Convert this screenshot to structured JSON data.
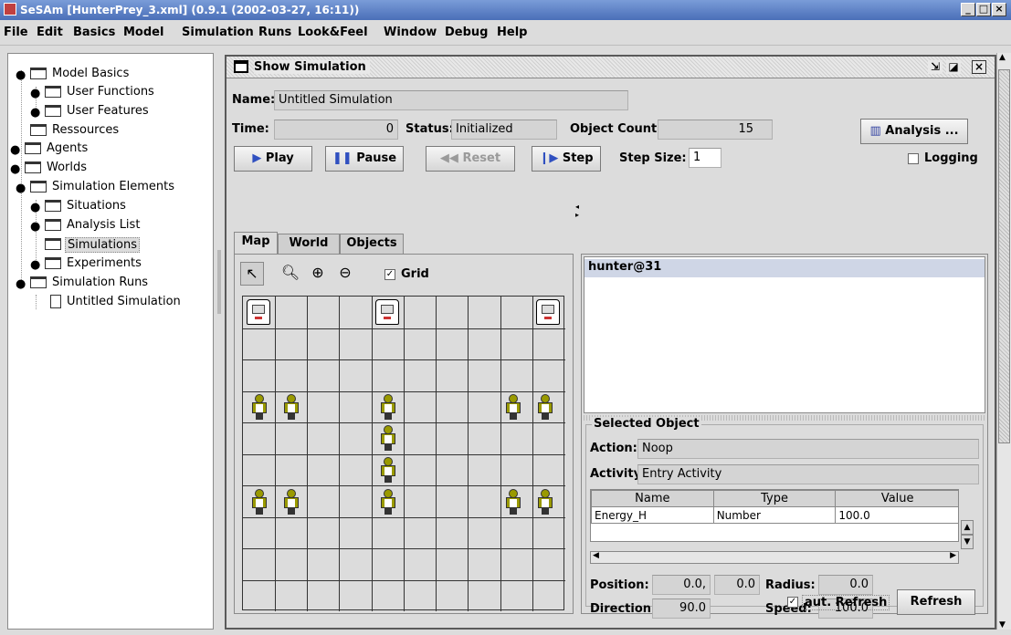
{
  "window": {
    "title": "SeSAm [HunterPrey_3.xml] (0.9.1 (2002-03-27, 16:11))",
    "min_label": "_",
    "max_label": "□",
    "close_label": "×"
  },
  "menu": [
    "File",
    "Edit",
    "Basics",
    "Model",
    "Simulation",
    "Runs",
    "Look&Feel",
    "Window",
    "Debug",
    "Help"
  ],
  "tree": [
    "Model Basics",
    "User Functions",
    "User Features",
    "Ressources",
    "Agents",
    "Worlds",
    "Simulation Elements",
    "Situations",
    "Analysis List",
    "Simulations",
    "Experiments",
    "Simulation Runs",
    "Untitled Simulation"
  ],
  "frame": {
    "title": "Show Simulation",
    "name_label": "Name:",
    "name_value": "Untitled Simulation",
    "time_label": "Time:",
    "time_value": "0",
    "status_label": "Status:",
    "status_value": "Initialized",
    "count_label": "Object Count:",
    "count_value": "15",
    "analysis_button": "Analysis ...",
    "play": "Play",
    "pause": "Pause",
    "reset": "Reset",
    "step": "Step",
    "step_size_label": "Step Size:",
    "step_size_value": "1",
    "logging_label": "Logging",
    "tabs": [
      "Map",
      "World",
      "Objects"
    ],
    "grid_label": "Grid",
    "aut_refresh_label": "aut. Refresh",
    "refresh_button": "Refresh"
  },
  "objects": {
    "selected": "hunter@31"
  },
  "selected_object": {
    "legend": "Selected Object",
    "action_label": "Action:",
    "action_value": "Noop",
    "activity_label": "Activity:",
    "activity_value": "Entry Activity",
    "columns": [
      "Name",
      "Type",
      "Value"
    ],
    "rows": [
      {
        "name": "Energy_H",
        "type": "Number",
        "value": "100.0"
      }
    ],
    "position_label": "Position:",
    "position_x": "0.0,",
    "position_y": "0.0",
    "radius_label": "Radius:",
    "radius_value": "0.0",
    "direction_label": "Direction:",
    "direction_value": "90.0",
    "speed_label": "Speed:",
    "speed_value": "100.0"
  }
}
